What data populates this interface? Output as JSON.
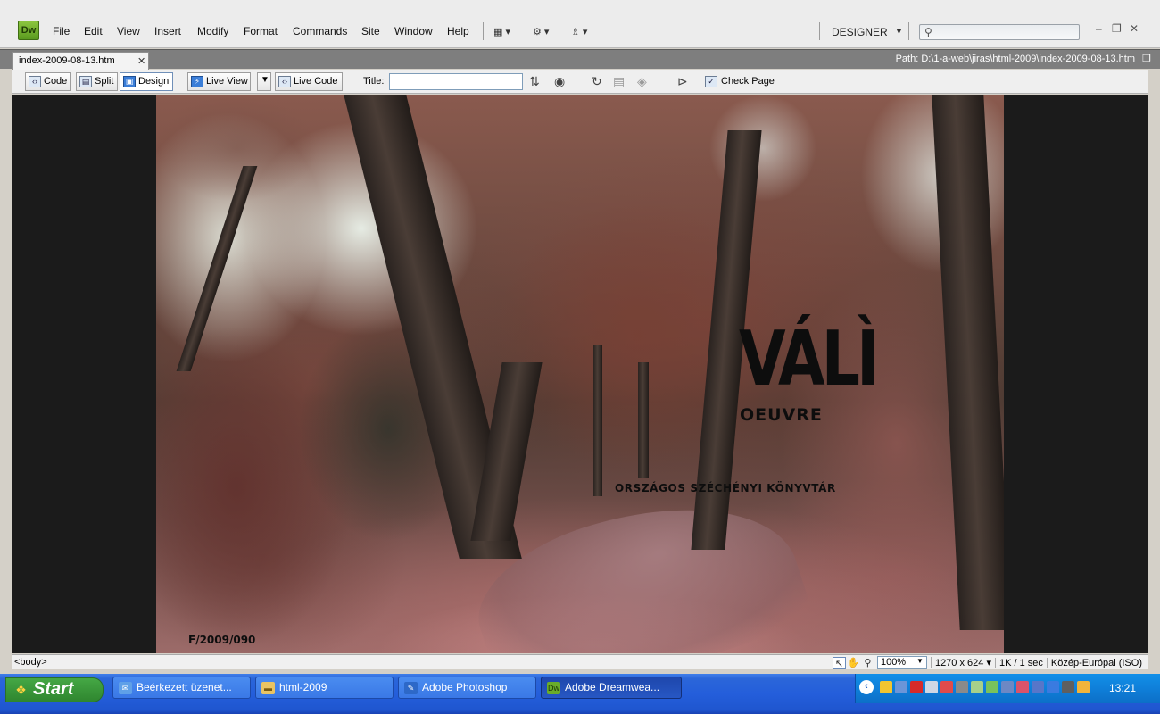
{
  "app": {
    "logo_text": "Dw"
  },
  "menu": {
    "items": [
      "File",
      "Edit",
      "View",
      "Insert",
      "Modify",
      "Format",
      "Commands",
      "Site",
      "Window",
      "Help"
    ],
    "workspace": "DESIGNER"
  },
  "document": {
    "tab_name": "index-2009-08-13.htm",
    "path": "Path:  D:\\1-a-web\\jiras\\html-2009\\index-2009-08-13.htm"
  },
  "toolbar": {
    "code": "Code",
    "split": "Split",
    "design": "Design",
    "live_view": "Live View",
    "live_code": "Live Code",
    "title_label": "Title:",
    "title_value": "",
    "check_page": "Check Page"
  },
  "page": {
    "logo_main": "VÁLÌ",
    "logo_sub": "OEUVRE",
    "library": "ORSZÁGOS SZÉCHÉNYI KÖNYVTÁR",
    "ref_code": "F/2009/090"
  },
  "statusbar": {
    "tag": "<body>",
    "zoom": "100%",
    "dimensions": "1270 x 624",
    "size_time": "1K / 1 sec",
    "encoding": "Közép-Európai (ISO)"
  },
  "taskbar": {
    "start": "Start",
    "tasks": [
      {
        "label": "Beérkezett üzenet...",
        "icon": "outlook-icon",
        "active": false
      },
      {
        "label": "html-2009",
        "icon": "folder-icon",
        "active": false
      },
      {
        "label": "Adobe Photoshop",
        "icon": "photoshop-icon",
        "active": false
      },
      {
        "label": "Adobe Dreamwea...",
        "icon": "dreamweaver-icon",
        "active": true
      }
    ],
    "clock": "13:21"
  },
  "colors": {
    "dw_green": "#6aac2a",
    "taskbar_blue": "#245edb",
    "start_green": "#3c9a3c",
    "tray_blue": "#0f7fd9"
  }
}
